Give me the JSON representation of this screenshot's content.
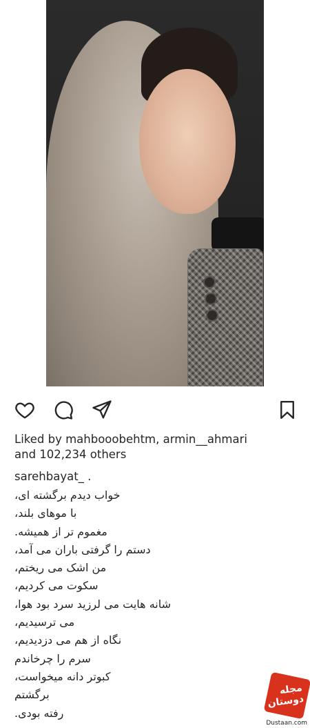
{
  "post": {
    "image_alt": "portrait",
    "likes_line1": "Liked by mahbooobehtm, armin__ahmari",
    "likes_line2": "and 102,234 others",
    "username": "sarehbayat_ .",
    "caption_lines": [
      "خواب دیدم برگشته ای،",
      "با موهای بلند،",
      "مغموم تر از همیشه.",
      "دستم را گرفتی باران می آمد،",
      "من اشک می ریختم،",
      "سکوت می کردیم،",
      "شانه هایت می لرزید سرد بود هوا،",
      "می ترسیدیم،",
      "نگاه از هم می دزدیدیم،",
      "سرم را چرخاندم",
      "کبوتر دانه میخواست،",
      "برگشتم",
      "رفته بودی."
    ]
  },
  "actions": {
    "like_icon": "heart-icon",
    "comment_icon": "comment-icon",
    "share_icon": "send-icon",
    "save_icon": "bookmark-icon"
  },
  "watermark": {
    "logo_text": "مجله دوستان",
    "url": "Dustaan.com"
  }
}
